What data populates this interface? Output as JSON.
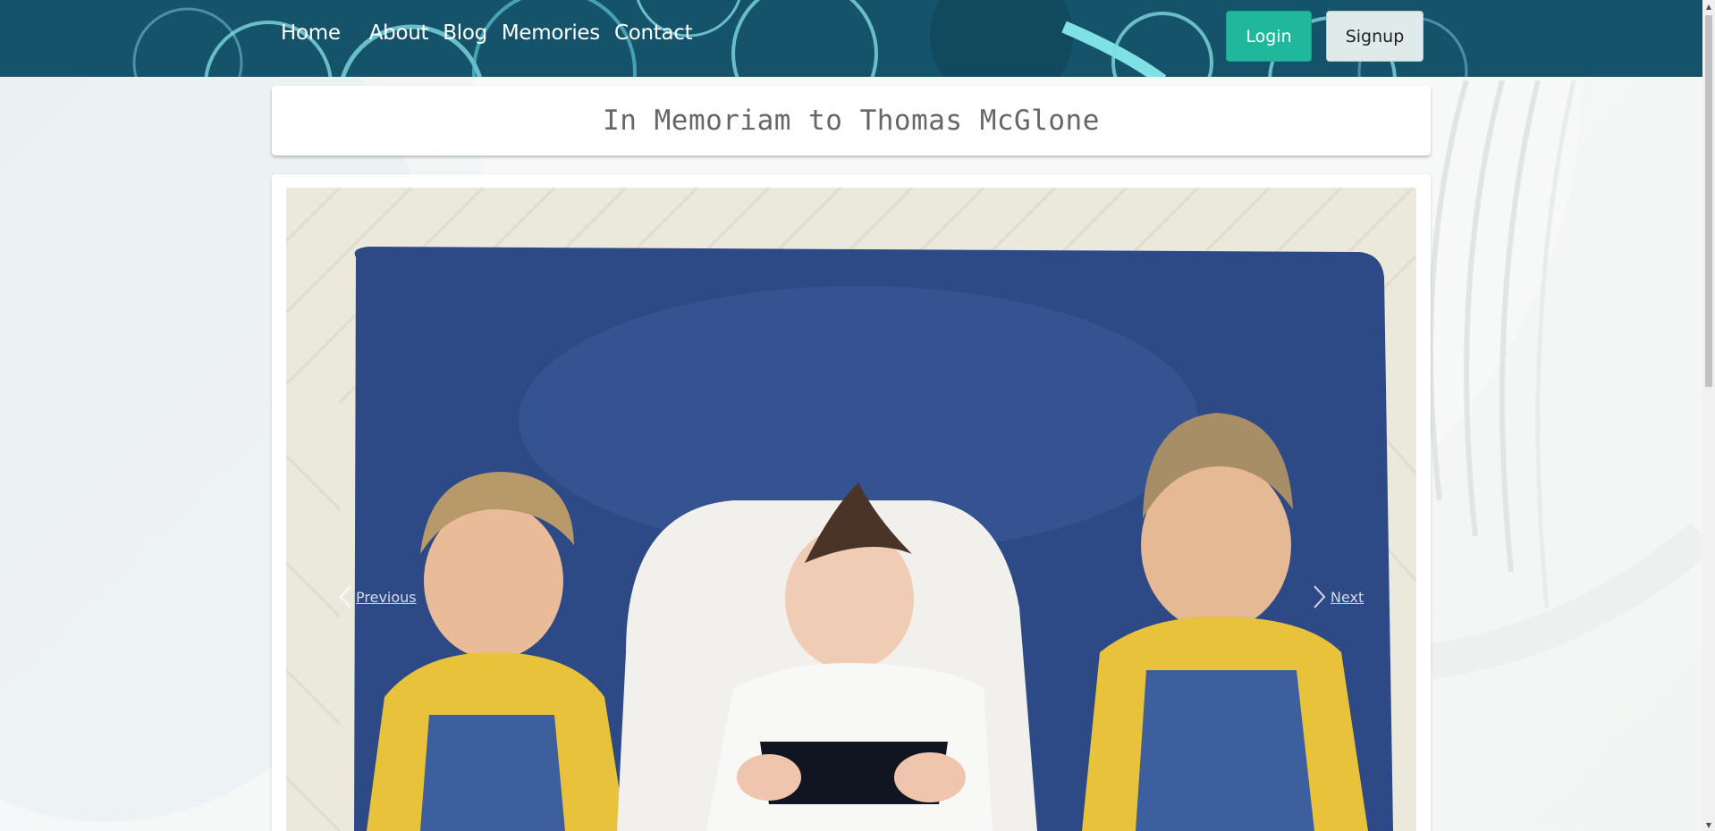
{
  "nav": {
    "links": [
      "Home",
      "About",
      "Blog",
      "Memories",
      "Contact"
    ],
    "login_label": "Login",
    "signup_label": "Signup"
  },
  "page": {
    "title": "In Memoriam to Thomas McGlone"
  },
  "carousel": {
    "prev_label": "Previous",
    "next_label": "Next"
  },
  "colors": {
    "navbar": "#15536a",
    "login_button": "#1fb89c",
    "signup_button": "#dfeaea"
  },
  "icons": {
    "prev": "chevron-left-icon",
    "next": "chevron-right-icon"
  }
}
